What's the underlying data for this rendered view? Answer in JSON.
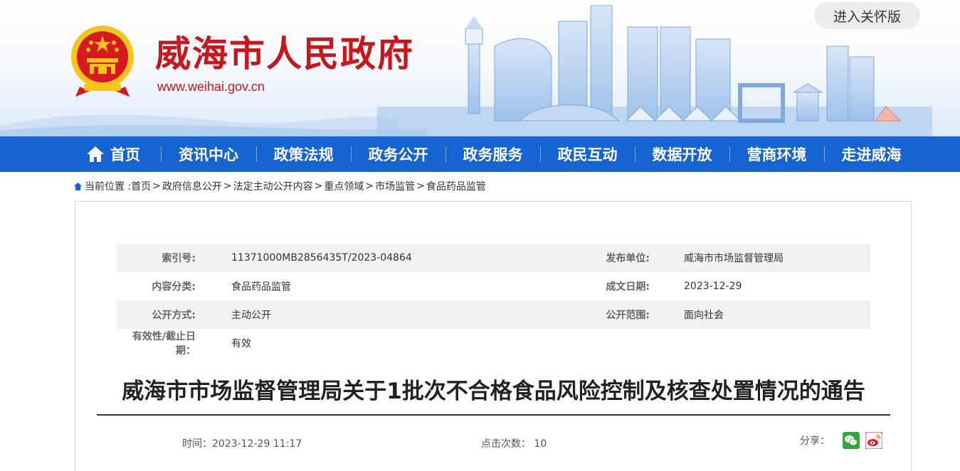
{
  "header": {
    "site_title": "威海市人民政府",
    "site_url": "www.weihai.gov.cn",
    "care_mode_button": "进入关怀版",
    "colors": {
      "brand_red": "#c8161d",
      "nav_blue": "#1663d2",
      "emblem_gold": "#f5c518"
    }
  },
  "nav": {
    "items": [
      {
        "label": "首页",
        "icon": "home-icon"
      },
      {
        "label": "资讯中心"
      },
      {
        "label": "政策法规"
      },
      {
        "label": "政务公开"
      },
      {
        "label": "政务服务"
      },
      {
        "label": "政民互动"
      },
      {
        "label": "数据开放"
      },
      {
        "label": "营商环境"
      },
      {
        "label": "走进威海"
      }
    ]
  },
  "breadcrumb": {
    "prefix": "当前位置 :",
    "items": [
      "首页",
      "政府信息公开",
      "法定主动公开内容",
      "重点领域",
      "市场监管",
      "食品药品监管"
    ],
    "separator": ">"
  },
  "meta": {
    "index_no_label": "索引号:",
    "index_no": "11371000MB2856435T/2023-04864",
    "publisher_label": "发布单位:",
    "publisher": "威海市市场监督管理局",
    "category_label": "内容分类:",
    "category": "食品药品监管",
    "written_date_label": "成文日期:",
    "written_date": "2023-12-29",
    "disclosure_label": "公开方式:",
    "disclosure": "主动公开",
    "scope_label": "公开范围:",
    "scope": "面向社会",
    "validity_label": "有效性/截止日期：",
    "validity": "有效"
  },
  "article": {
    "title": "威海市市场监督管理局关于1批次不合格食品风险控制及核查处置情况的通告",
    "time_label": "时间：",
    "time": "2023-12-29 11:17",
    "clicks_label": "点击次数：",
    "clicks": "10",
    "share_label": "分享：",
    "share_buttons": [
      "wechat-icon",
      "weibo-icon"
    ]
  }
}
